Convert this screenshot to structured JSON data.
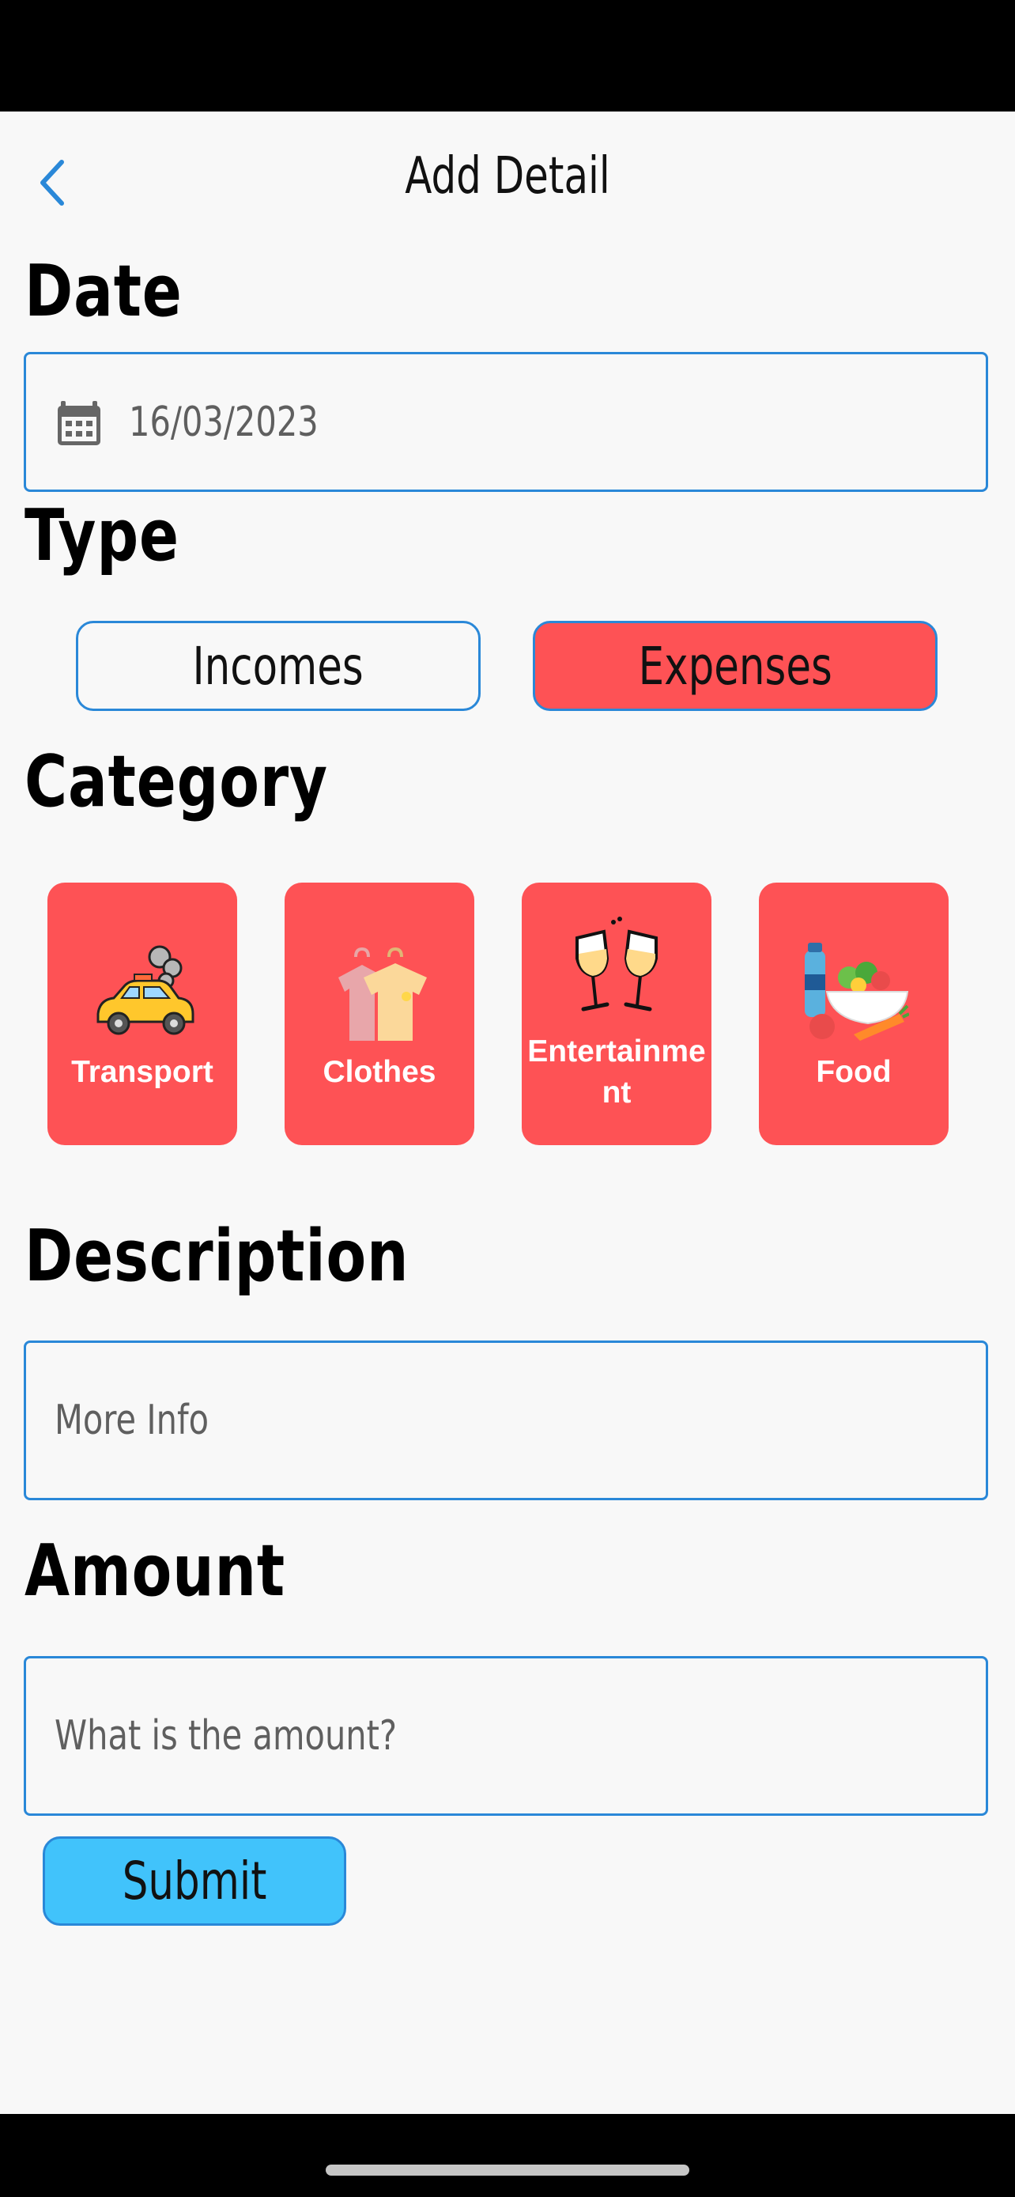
{
  "header": {
    "title": "Add Detail"
  },
  "date": {
    "heading": "Date",
    "value": "16/03/2023"
  },
  "type": {
    "heading": "Type",
    "options": [
      "Incomes",
      "Expenses"
    ],
    "selected": "Expenses"
  },
  "category": {
    "heading": "Category",
    "items": [
      {
        "label": "Transport",
        "icon": "taxi-car-icon"
      },
      {
        "label": "Clothes",
        "icon": "shirts-on-hangers-icon"
      },
      {
        "label": "Entertainment",
        "icon": "champagne-glasses-icon"
      },
      {
        "label": "Food",
        "icon": "salad-bowl-icon"
      }
    ]
  },
  "description": {
    "heading": "Description",
    "placeholder": "More Info"
  },
  "amount": {
    "heading": "Amount",
    "placeholder": "What is the amount?"
  },
  "submit": {
    "label": "Submit"
  },
  "colors": {
    "accent_blue": "#2a88d8",
    "category_red": "#fe5255",
    "submit_blue": "#41c3fb",
    "background": "#f8f8f8"
  }
}
